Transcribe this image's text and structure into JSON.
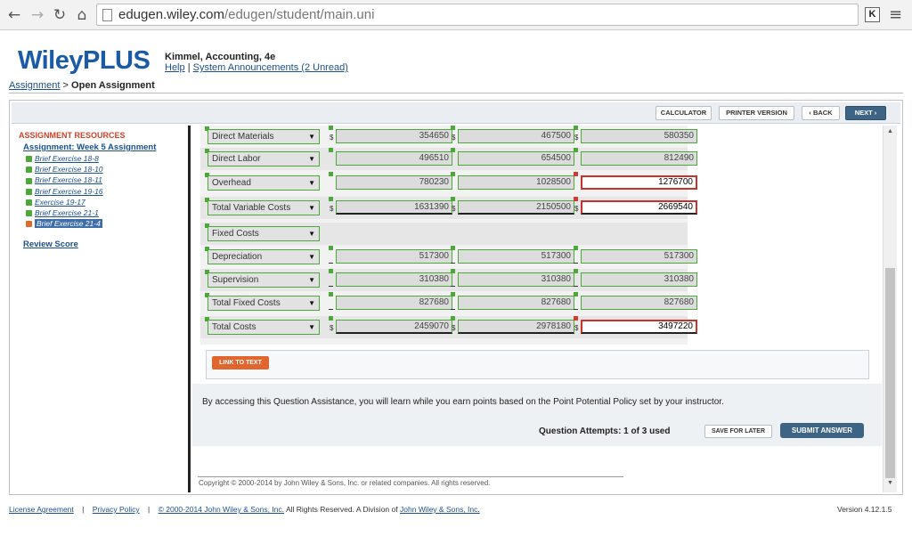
{
  "browser": {
    "url_host": "edugen.wiley.com",
    "url_path": "/edugen/student/main.uni",
    "extension_label": "K"
  },
  "header": {
    "logo": "WileyPLUS",
    "course_title": "Kimmel, Accounting, 4e",
    "help_link": "Help",
    "separator": "|",
    "announcements_link": "System Announcements (2 Unread)"
  },
  "breadcrumb": {
    "parent": "Assignment",
    "separator": ">",
    "current": "Open Assignment"
  },
  "toolbar": {
    "calculator": "CALCULATOR",
    "printer_version": "PRINTER VERSION",
    "back": "‹ BACK",
    "next": "NEXT ›"
  },
  "sidebar": {
    "title": "ASSIGNMENT RESOURCES",
    "assignment_link": "Assignment: Week 5 Assignment",
    "items": [
      {
        "label": "Brief Exercise 18-8",
        "status": "correct"
      },
      {
        "label": "Brief Exercise 18-10",
        "status": "correct"
      },
      {
        "label": "Brief Exercise 18-11",
        "status": "correct"
      },
      {
        "label": "Brief Exercise 19-16",
        "status": "correct"
      },
      {
        "label": "Exercise 19-17",
        "status": "correct"
      },
      {
        "label": "Brief Exercise 21-1",
        "status": "correct"
      },
      {
        "label": "Brief Exercise 21-4",
        "status": "current"
      }
    ],
    "review_score": "Review Score"
  },
  "table": {
    "currency_symbol": "$",
    "dropdown_arrow": "▼",
    "rows": [
      {
        "label": "Direct Materials",
        "values": [
          "354650",
          "467500",
          "580350"
        ]
      },
      {
        "label": "Direct Labor",
        "values": [
          "496510",
          "654500",
          "812490"
        ]
      },
      {
        "label": "Overhead",
        "values": [
          "780230",
          "1028500",
          "1276700"
        ]
      },
      {
        "label": "Total Variable Costs",
        "values": [
          "1631390",
          "2150500",
          "2669540"
        ]
      },
      {
        "label": "Fixed Costs",
        "values": []
      },
      {
        "label": "Depreciation",
        "values": [
          "517300",
          "517300",
          "517300"
        ]
      },
      {
        "label": "Supervision",
        "values": [
          "310380",
          "310380",
          "310380"
        ]
      },
      {
        "label": "Total Fixed Costs",
        "values": [
          "827680",
          "827680",
          "827680"
        ]
      },
      {
        "label": "Total Costs",
        "values": [
          "2459070",
          "2978180",
          "3497220"
        ]
      }
    ]
  },
  "link_to_text": "LINK TO TEXT",
  "assistance_text": "By accessing this Question Assistance, you will learn while you earn points based on the Point Potential Policy set by your instructor.",
  "attempts": "Question Attempts: 1 of 3 used",
  "save_for_later": "SAVE FOR LATER",
  "submit_answer": "SUBMIT ANSWER",
  "copyright": "Copyright © 2000-2014 by John Wiley & Sons, Inc. or related companies. All rights reserved.",
  "footer": {
    "license": "License Agreement",
    "privacy": "Privacy Policy",
    "separator": "|",
    "copyright_link": "© 2000-2014 John Wiley & Sons, Inc.",
    "rights_text": "All Rights Reserved. A Division of",
    "division_link": "John Wiley & Sons, Inc.",
    "version": "Version 4.12.1.5"
  }
}
